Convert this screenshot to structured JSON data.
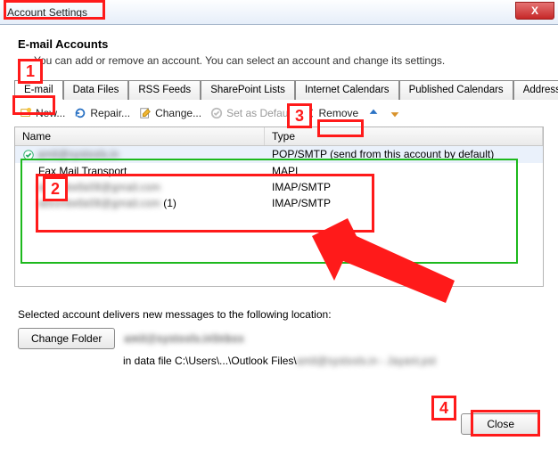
{
  "window": {
    "title": "Account Settings",
    "close": "X"
  },
  "section": {
    "title": "E-mail Accounts",
    "desc": "You can add or remove an account. You can select an account and change its settings."
  },
  "tabs": [
    "E-mail",
    "Data Files",
    "RSS Feeds",
    "SharePoint Lists",
    "Internet Calendars",
    "Published Calendars",
    "Address Books"
  ],
  "toolbar": {
    "new": "New...",
    "repair": "Repair...",
    "change": "Change...",
    "setdefault": "Set as Default",
    "remove": "Remove"
  },
  "list": {
    "header_name": "Name",
    "header_type": "Type",
    "rows": [
      {
        "name_prefix": "",
        "name_blur": "amit@systools.in",
        "type": "POP/SMTP (send from this account by default)"
      },
      {
        "name_prefix": "Fax Mail Transport",
        "name_blur": "",
        "type": "MAPI"
      },
      {
        "name_prefix": "",
        "name_blur": "alisonbella08@gmail.com",
        "type": "IMAP/SMTP"
      },
      {
        "name_prefix": "",
        "name_blur": "alisonbella08@gmail.com",
        "name_suffix": " (1)",
        "type": "IMAP/SMTP"
      }
    ]
  },
  "delivery": {
    "label": "Selected account delivers new messages to the following location:",
    "change_folder": "Change Folder",
    "path_blur": "amit@systools.in\\Inbox",
    "datafile_prefix": "in data file C:\\Users\\...\\Outlook Files\\",
    "datafile_blur": "amit@systools.in - Jayant.pst"
  },
  "buttons": {
    "close": "Close"
  },
  "markers": {
    "1": "1",
    "2": "2",
    "3": "3",
    "4": "4"
  }
}
